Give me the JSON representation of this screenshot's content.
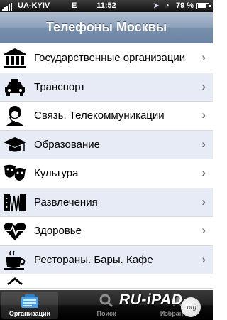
{
  "status_bar": {
    "carrier": "UA-KYIV",
    "network": "E",
    "time": "11:52",
    "battery_percent": "79 %",
    "battery_level": 0.79
  },
  "navbar": {
    "title": "Телефоны Москвы"
  },
  "list": {
    "items": [
      {
        "label": "Государственные организации",
        "icon": "government-building-icon"
      },
      {
        "label": "Транспорт",
        "icon": "taxi-icon"
      },
      {
        "label": "Связь. Телекоммуникации",
        "icon": "operator-headset-icon"
      },
      {
        "label": "Образование",
        "icon": "graduation-cap-icon"
      },
      {
        "label": "Культура",
        "icon": "theater-masks-icon"
      },
      {
        "label": "Развлечения",
        "icon": "accordion-icon"
      },
      {
        "label": "Здоровье",
        "icon": "heart-pulse-icon"
      },
      {
        "label": "Рестораны. Бары. Кафе",
        "icon": "coffee-cup-icon"
      }
    ]
  },
  "tabbar": {
    "tabs": [
      {
        "label": "Организации",
        "icon": "organizations-icon",
        "active": true
      },
      {
        "label": "Поиск",
        "icon": "search-icon",
        "active": false
      },
      {
        "label": "Избранное",
        "icon": "favorites-icon",
        "active": false
      }
    ]
  },
  "watermark": {
    "text": "RU-iPAD",
    "suffix": ".org"
  },
  "colors": {
    "navbar": "#7990ac",
    "alt_row": "#e6ebf5",
    "tabbar": "#111111"
  }
}
